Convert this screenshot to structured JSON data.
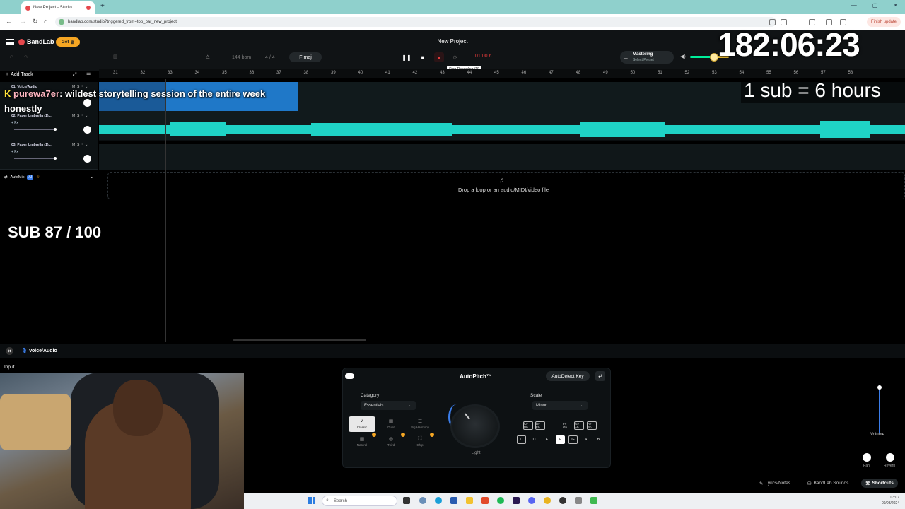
{
  "browser": {
    "tab_title": "New Project - Studio",
    "url": "bandlab.com/studio?triggered_from=top_bar_new_project",
    "finish_update": "Finish update"
  },
  "app": {
    "logo": "BandLab",
    "get_button": "Get",
    "project_title": "New Project",
    "bpm_value": "144",
    "bpm_unit": "bpm",
    "time_signature": "4 / 4",
    "key": "F maj",
    "timecode": "01:00.6",
    "tooltip": "Stop Recording (R)",
    "mastering_title": "Mastering",
    "mastering_preset": "Select Preset",
    "add_track": "Add Track",
    "ruler": [
      "31",
      "32",
      "33",
      "34",
      "35",
      "36",
      "37",
      "38",
      "39",
      "40",
      "41",
      "42",
      "43",
      "44",
      "45",
      "46",
      "47",
      "48",
      "49",
      "50",
      "51",
      "52",
      "53",
      "54",
      "55",
      "56",
      "57",
      "58"
    ]
  },
  "tracks": [
    {
      "name": "01. Voice/Audio",
      "fx": "+ Fx",
      "mute": "M",
      "solo": "S"
    },
    {
      "name": "02. Paper Umbrella (1)...",
      "fx": "+ Fx",
      "mute": "M",
      "solo": "S"
    },
    {
      "name": "03. Paper Umbrella (1)...",
      "fx": "+ Fx",
      "mute": "M",
      "solo": "S"
    }
  ],
  "automix": {
    "label": "AutoMix",
    "badge": "AI"
  },
  "dropzone": "Drop a loop or an audio/MIDI/video file",
  "overlay": {
    "timer": "182:06:23",
    "sub_rule": "1 sub = 6 hours",
    "chat_user_prefix": "K",
    "chat_user": "purewa7er",
    "chat_message": ": wildest storytelling session of the entire week",
    "chat_message_2": "honestly",
    "sub_goal": "SUB 87 / 100"
  },
  "panel": {
    "track_label": "Voice/Audio",
    "input_label": "Input",
    "autopitch_title": "AutoPitch™",
    "autodetect": "AutoDetect Key",
    "category_label": "Category",
    "category_value": "Essentials",
    "scale_label": "Scale",
    "scale_value": "Minor",
    "styles": [
      "Classic",
      "Duet",
      "Big Harmony",
      "Natural",
      "Third",
      "Chip"
    ],
    "knob_label": "Light",
    "sharps": [
      "C# Db",
      "D# Eb",
      "F# Gb",
      "G# Ab",
      "A# Bb"
    ],
    "notes": [
      "C",
      "D",
      "E",
      "F",
      "G",
      "A",
      "B"
    ],
    "volume_label": "Volume",
    "pan_label": "Pan",
    "reverb_label": "Reverb",
    "lyrics_button": "Lyrics/Notes",
    "sounds_button": "BandLab Sounds",
    "shortcuts_button": "Shortcuts"
  },
  "taskbar": {
    "search_placeholder": "Search",
    "time": "03:07",
    "date": "09/08/2024"
  },
  "colors": {
    "accent": "#3b7de9",
    "record": "#e03a3a",
    "waveform": "#1fd3c6",
    "clip": "#1f78c8"
  }
}
